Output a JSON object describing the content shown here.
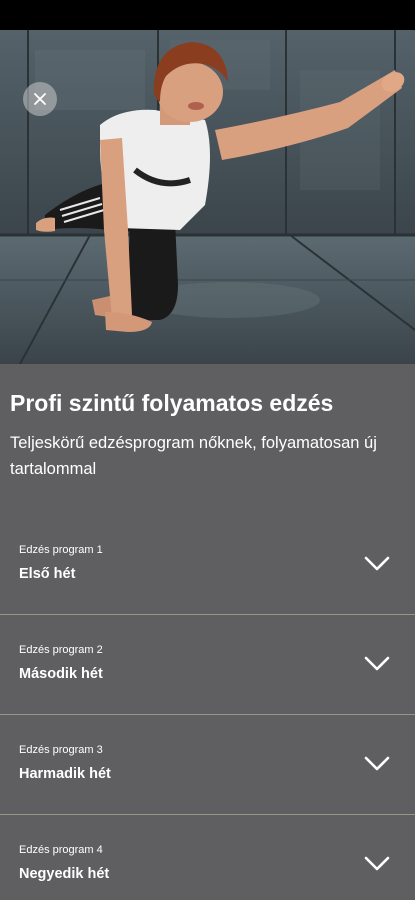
{
  "app": {
    "title": "Profi szintű folyamatos edzés",
    "subtitle": "Teljeskörű edzésprogram nőknek, folyamatosan új tartalommal"
  },
  "hero": {
    "image": "woman-exercise-photo"
  },
  "icons": {
    "close": "close-icon",
    "expand": "chevron-down-icon"
  },
  "colors": {
    "background": "#5f5f62",
    "status_bar": "#000000",
    "divider": "#8e9a86",
    "text": "#ffffff"
  },
  "programs": [
    {
      "caption": "Edzés program 1",
      "name": "Első hét"
    },
    {
      "caption": "Edzés program 2",
      "name": "Második hét"
    },
    {
      "caption": "Edzés program 3",
      "name": "Harmadik hét"
    },
    {
      "caption": "Edzés program 4",
      "name": "Negyedik hét"
    }
  ]
}
